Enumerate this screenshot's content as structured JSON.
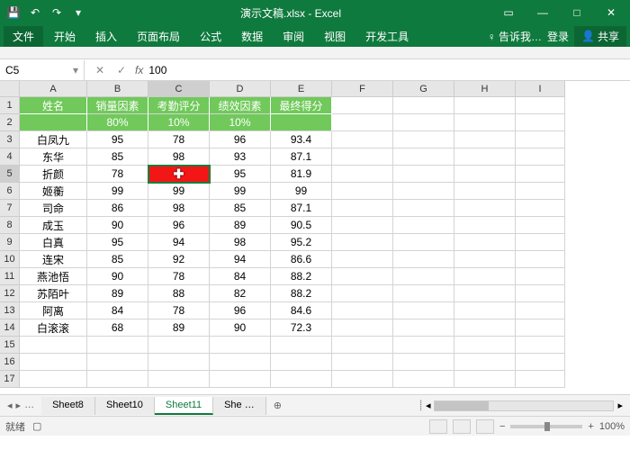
{
  "title": "演示文稿.xlsx - Excel",
  "ribbon": {
    "file": "文件",
    "tabs": [
      "开始",
      "插入",
      "页面布局",
      "公式",
      "数据",
      "审阅",
      "视图",
      "开发工具"
    ],
    "tell": "告诉我…",
    "login": "登录",
    "share": "共享"
  },
  "namebox": "C5",
  "formula": "100",
  "colHeaders": [
    "A",
    "B",
    "C",
    "D",
    "E",
    "F",
    "G",
    "H",
    "I"
  ],
  "rowHeaders": [
    1,
    2,
    3,
    4,
    5,
    6,
    7,
    8,
    9,
    10,
    11,
    12,
    13,
    14,
    15,
    16,
    17
  ],
  "header1": {
    "A": "姓名",
    "B": "销量因素",
    "C": "考勤评分",
    "D": "绩效因素",
    "E": "最终得分"
  },
  "header2": {
    "B": "80%",
    "C": "10%",
    "D": "10%"
  },
  "rows": [
    {
      "A": "白凤九",
      "B": 95,
      "C": 78,
      "D": 96,
      "E": 93.4
    },
    {
      "A": "东华",
      "B": 85,
      "C": 98,
      "D": 93,
      "E": 87.1
    },
    {
      "A": "折颜",
      "B": 78,
      "C": "",
      "D": 95,
      "E": 81.9
    },
    {
      "A": "姬蘅",
      "B": 99,
      "C": 99,
      "D": 99,
      "E": 99
    },
    {
      "A": "司命",
      "B": 86,
      "C": 98,
      "D": 85,
      "E": 87.1
    },
    {
      "A": "成玉",
      "B": 90,
      "C": 96,
      "D": 89,
      "E": 90.5
    },
    {
      "A": "白真",
      "B": 95,
      "C": 94,
      "D": 98,
      "E": 95.2
    },
    {
      "A": "连宋",
      "B": 85,
      "C": 92,
      "D": 94,
      "E": 86.6
    },
    {
      "A": "燕池悟",
      "B": 90,
      "C": 78,
      "D": 84,
      "E": 88.2
    },
    {
      "A": "苏陌叶",
      "B": 89,
      "C": 88,
      "D": 82,
      "E": 88.2
    },
    {
      "A": "阿离",
      "B": 84,
      "C": 78,
      "D": 96,
      "E": 84.6
    },
    {
      "A": "白滚滚",
      "B": 68,
      "C": 89,
      "D": 90,
      "E": 72.3
    }
  ],
  "sheets": {
    "list": [
      "Sheet8",
      "Sheet10",
      "Sheet11",
      "She …"
    ],
    "active": "Sheet11",
    "add": "⊕"
  },
  "status": {
    "ready": "就绪",
    "zoom": "100%"
  },
  "selectedCell": {
    "row": 5,
    "col": "C",
    "rawValue": 100
  },
  "chart_data": {
    "type": "table",
    "title": "最终得分",
    "columns": [
      "姓名",
      "销量因素 80%",
      "考勤评分 10%",
      "绩效因素 10%",
      "最终得分"
    ],
    "records": [
      [
        "白凤九",
        95,
        78,
        96,
        93.4
      ],
      [
        "东华",
        85,
        98,
        93,
        87.1
      ],
      [
        "折颜",
        78,
        100,
        95,
        81.9
      ],
      [
        "姬蘅",
        99,
        99,
        99,
        99
      ],
      [
        "司命",
        86,
        98,
        85,
        87.1
      ],
      [
        "成玉",
        90,
        96,
        89,
        90.5
      ],
      [
        "白真",
        95,
        94,
        98,
        95.2
      ],
      [
        "连宋",
        85,
        92,
        94,
        86.6
      ],
      [
        "燕池悟",
        90,
        78,
        84,
        88.2
      ],
      [
        "苏陌叶",
        89,
        88,
        82,
        88.2
      ],
      [
        "阿离",
        84,
        78,
        96,
        84.6
      ],
      [
        "白滚滚",
        68,
        89,
        90,
        72.3
      ]
    ]
  }
}
